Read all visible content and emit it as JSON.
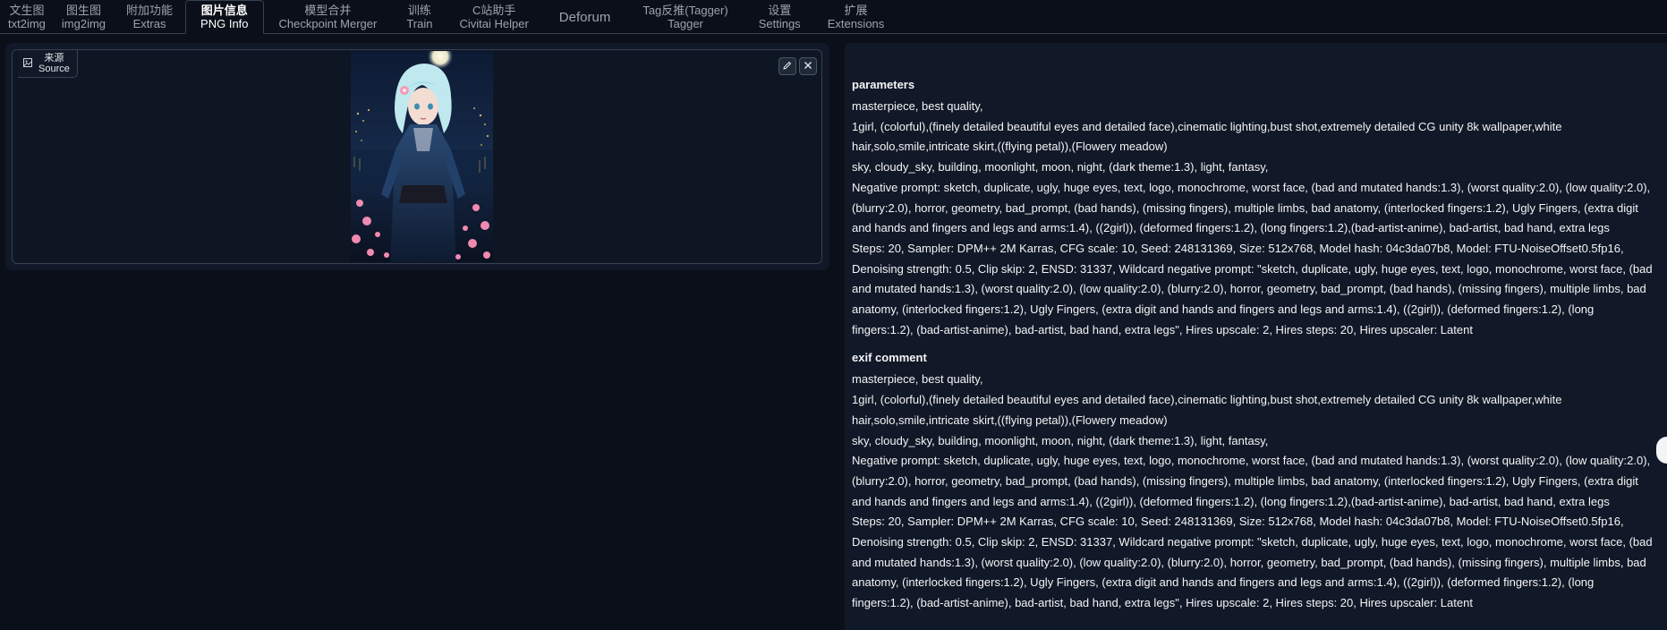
{
  "tabs": [
    {
      "line1": "文生图",
      "line2": "txt2img",
      "selected": false
    },
    {
      "line1": "图生图",
      "line2": "img2img",
      "selected": false
    },
    {
      "line1": "附加功能",
      "line2": "Extras",
      "selected": false
    },
    {
      "line1": "图片信息",
      "line2": "PNG Info",
      "selected": true
    },
    {
      "line1": "模型合并",
      "line2": "Checkpoint Merger",
      "selected": false
    },
    {
      "line1": "训练",
      "line2": "Train",
      "selected": false
    },
    {
      "line1": "C站助手",
      "line2": "Civitai Helper",
      "selected": false
    },
    {
      "line1": "Deforum",
      "line2": "",
      "selected": false
    },
    {
      "line1": "Tag反推(Tagger)",
      "line2": "Tagger",
      "selected": false
    },
    {
      "line1": "设置",
      "line2": "Settings",
      "selected": false
    },
    {
      "line1": "扩展",
      "line2": "Extensions",
      "selected": false
    }
  ],
  "source": {
    "label_cn": "来源",
    "label_en": "Source",
    "edit_icon": "pencil-icon",
    "clear_icon": "close-icon"
  },
  "info": {
    "parameters_heading": "parameters",
    "parameters_lines": [
      "masterpiece, best quality,",
      "1girl, (colorful),(finely detailed beautiful eyes and detailed face),cinematic lighting,bust shot,extremely detailed CG unity 8k wallpaper,white hair,solo,smile,intricate skirt,((flying petal)),(Flowery meadow)",
      "sky, cloudy_sky, building, moonlight, moon, night, (dark theme:1.3), light, fantasy,",
      "Negative prompt: sketch, duplicate, ugly, huge eyes, text, logo, monochrome, worst face, (bad and mutated hands:1.3), (worst quality:2.0), (low quality:2.0), (blurry:2.0), horror, geometry, bad_prompt, (bad hands), (missing fingers), multiple limbs, bad anatomy, (interlocked fingers:1.2), Ugly Fingers, (extra digit and hands and fingers and legs and arms:1.4), ((2girl)), (deformed fingers:1.2), (long fingers:1.2),(bad-artist-anime), bad-artist, bad hand, extra legs",
      "Steps: 20, Sampler: DPM++ 2M Karras, CFG scale: 10, Seed: 248131369, Size: 512x768, Model hash: 04c3da07b8, Model: FTU-NoiseOffset0.5fp16, Denoising strength: 0.5, Clip skip: 2, ENSD: 31337, Wildcard negative prompt: \"sketch, duplicate, ugly, huge eyes, text, logo, monochrome, worst face, (bad and mutated hands:1.3), (worst quality:2.0), (low quality:2.0), (blurry:2.0), horror, geometry, bad_prompt, (bad hands), (missing fingers), multiple limbs, bad anatomy, (interlocked fingers:1.2), Ugly Fingers, (extra digit and hands and fingers and legs and arms:1.4), ((2girl)), (deformed fingers:1.2), (long fingers:1.2), (bad-artist-anime), bad-artist, bad hand, extra legs\", Hires upscale: 2, Hires steps: 20, Hires upscaler: Latent"
    ],
    "exif_heading": "exif comment",
    "exif_lines": [
      "masterpiece, best quality,",
      "1girl, (colorful),(finely detailed beautiful eyes and detailed face),cinematic lighting,bust shot,extremely detailed CG unity 8k wallpaper,white hair,solo,smile,intricate skirt,((flying petal)),(Flowery meadow)",
      "sky, cloudy_sky, building, moonlight, moon, night, (dark theme:1.3), light, fantasy,",
      "Negative prompt: sketch, duplicate, ugly, huge eyes, text, logo, monochrome, worst face, (bad and mutated hands:1.3), (worst quality:2.0), (low quality:2.0), (blurry:2.0), horror, geometry, bad_prompt, (bad hands), (missing fingers), multiple limbs, bad anatomy, (interlocked fingers:1.2), Ugly Fingers, (extra digit and hands and fingers and legs and arms:1.4), ((2girl)), (deformed fingers:1.2), (long fingers:1.2),(bad-artist-anime), bad-artist, bad hand, extra legs",
      "Steps: 20, Sampler: DPM++ 2M Karras, CFG scale: 10, Seed: 248131369, Size: 512x768, Model hash: 04c3da07b8, Model: FTU-NoiseOffset0.5fp16, Denoising strength: 0.5, Clip skip: 2, ENSD: 31337, Wildcard negative prompt: \"sketch, duplicate, ugly, huge eyes, text, logo, monochrome, worst face, (bad and mutated hands:1.3), (worst quality:2.0), (low quality:2.0), (blurry:2.0), horror, geometry, bad_prompt, (bad hands), (missing fingers), multiple limbs, bad anatomy, (interlocked fingers:1.2), Ugly Fingers, (extra digit and hands and fingers and legs and arms:1.4), ((2girl)), (deformed fingers:1.2), (long fingers:1.2), (bad-artist-anime), bad-artist, bad hand, extra legs\", Hires upscale: 2, Hires steps: 20, Hires upscaler: Latent"
    ]
  },
  "colors": {
    "background": "#0b0f19",
    "panel": "#111827",
    "border": "#374151",
    "text": "#f3f4f6"
  }
}
